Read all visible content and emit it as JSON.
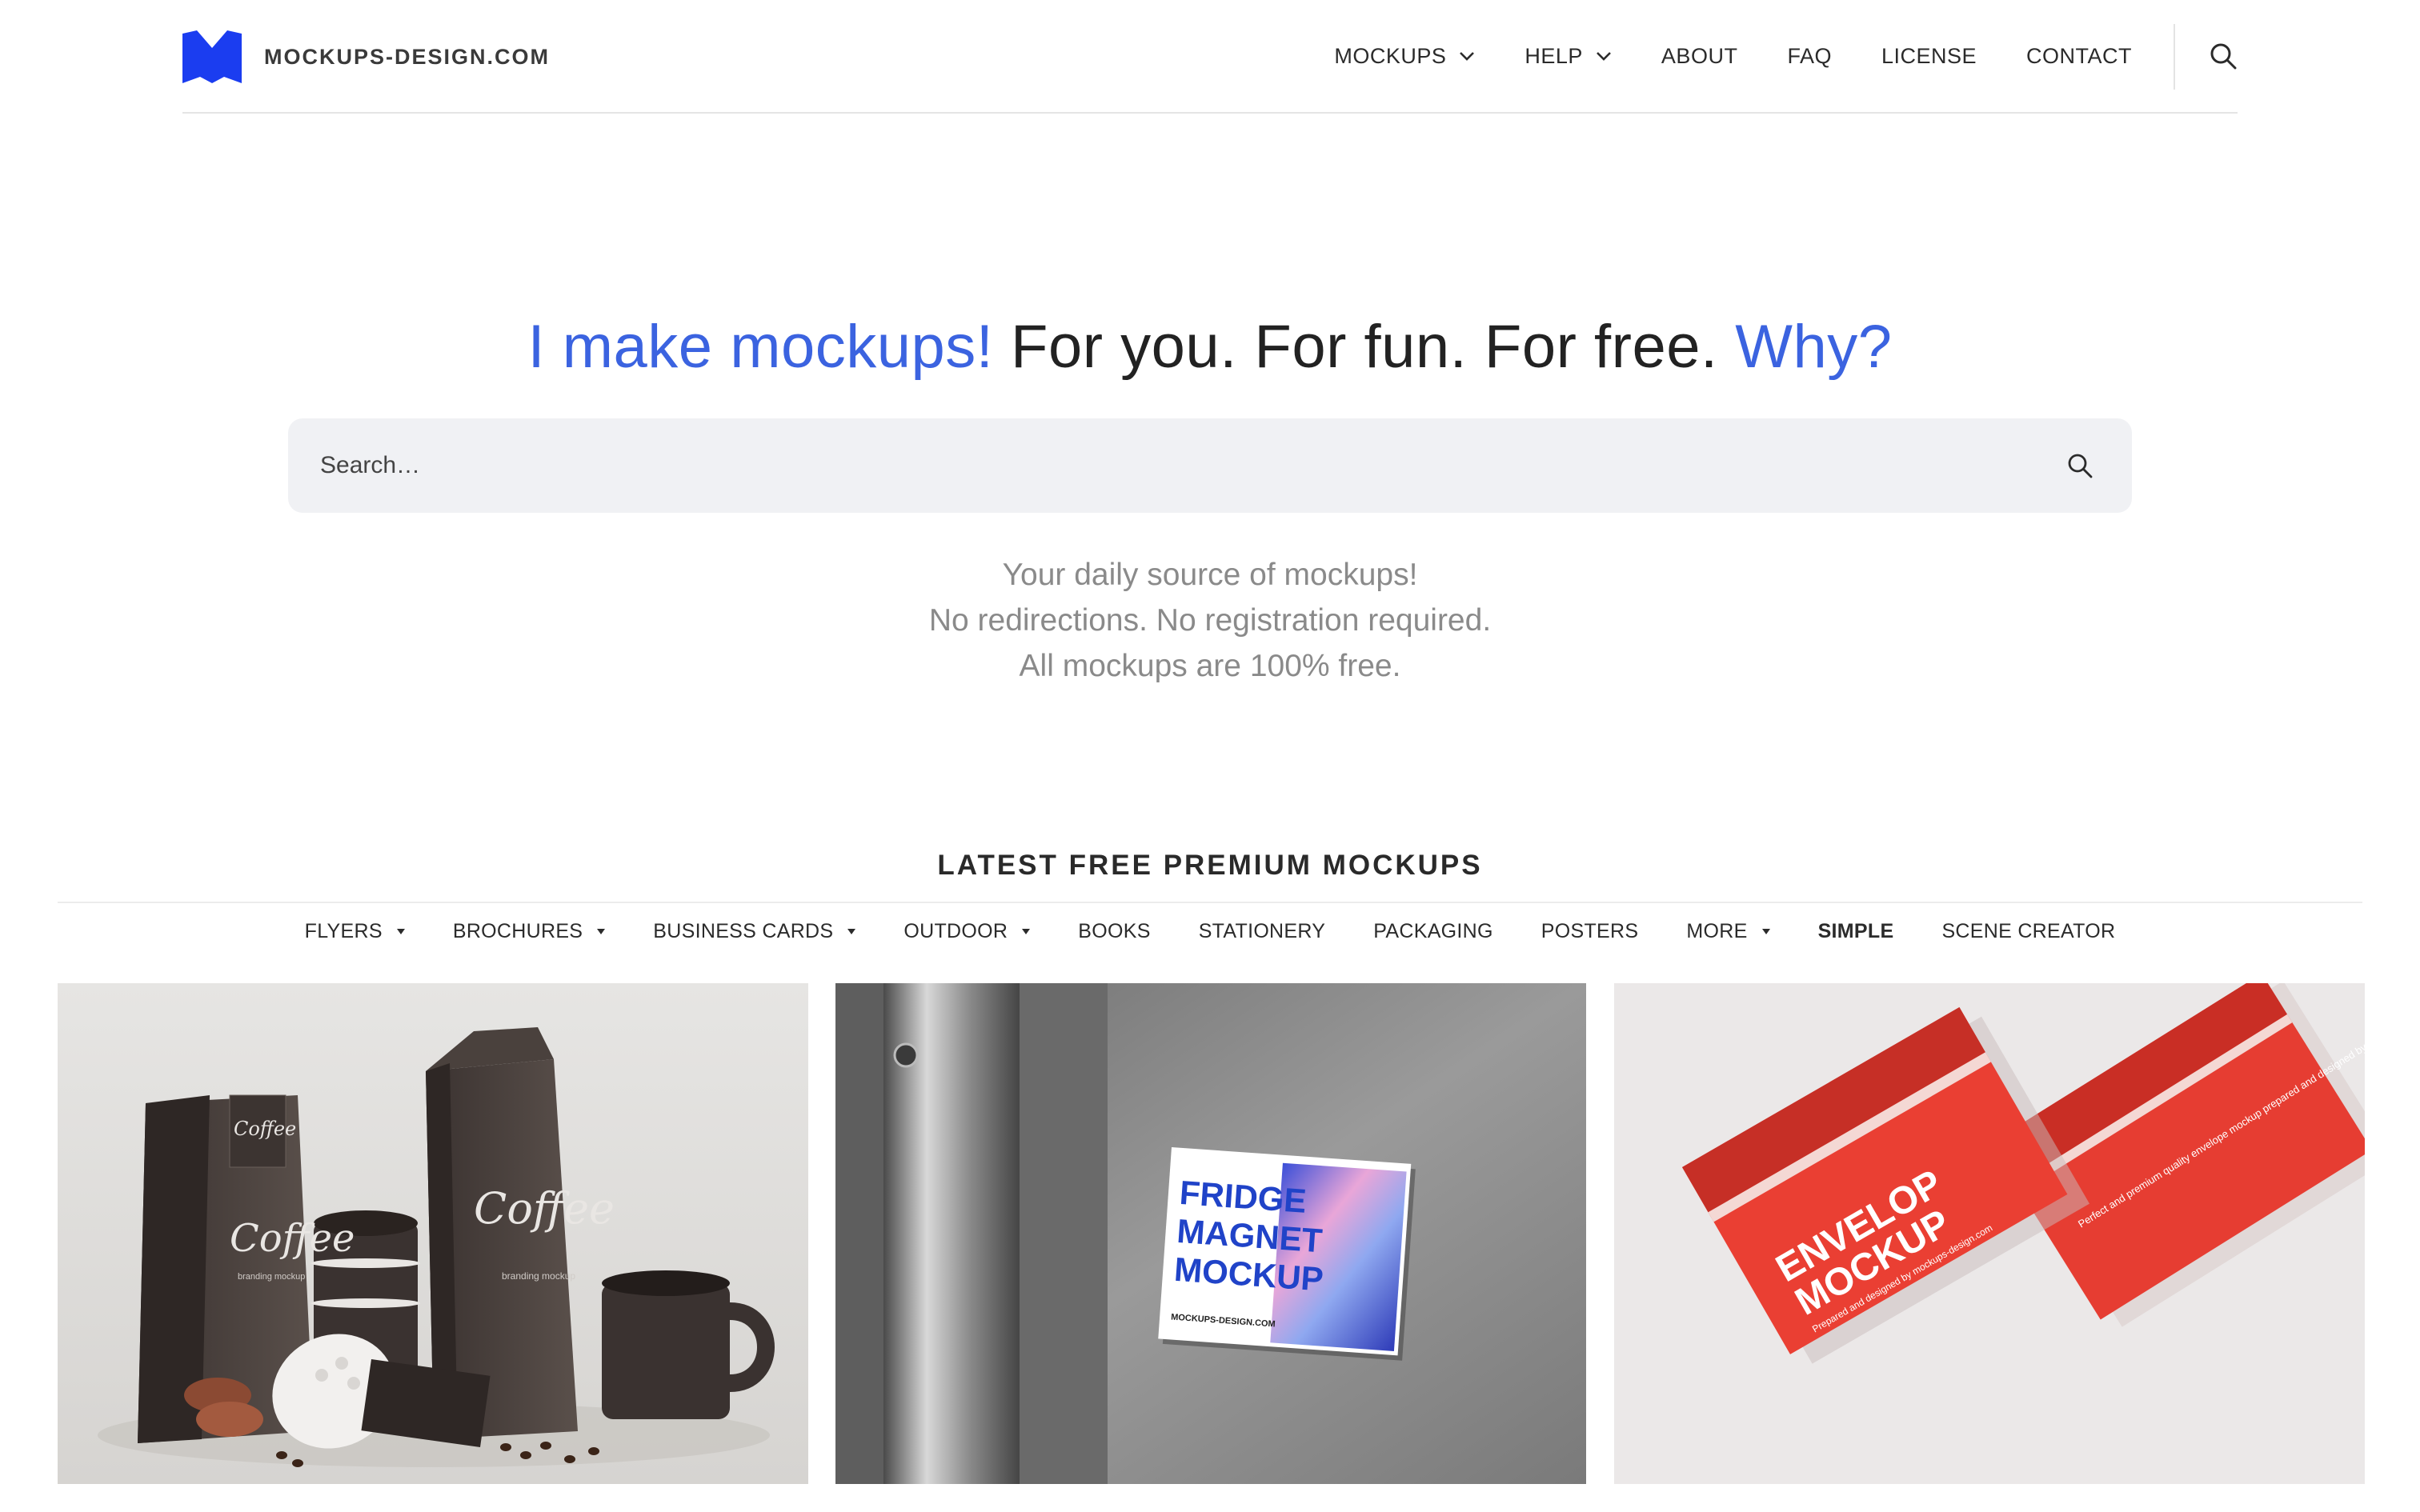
{
  "header": {
    "logo_text": "MOCKUPS-DESIGN.COM",
    "logo_color": "#1b3df0",
    "nav": [
      {
        "label": "MOCKUPS",
        "dropdown": true
      },
      {
        "label": "HELP",
        "dropdown": true
      },
      {
        "label": "ABOUT",
        "dropdown": false
      },
      {
        "label": "FAQ",
        "dropdown": false
      },
      {
        "label": "LICENSE",
        "dropdown": false
      },
      {
        "label": "CONTACT",
        "dropdown": false
      }
    ],
    "search_icon": "search-icon"
  },
  "hero": {
    "title_accent": "I make mockups!",
    "title_plain": " For you. For fun. For free. ",
    "title_link": "Why?",
    "accent_color": "#3b63e0",
    "search_placeholder": "Search…",
    "tagline": [
      "Your daily source of mockups!",
      "No redirections. No registration required.",
      "All mockups are 100% free."
    ]
  },
  "latest": {
    "title": "LATEST FREE PREMIUM MOCKUPS",
    "categories": [
      {
        "label": "FLYERS",
        "dropdown": true
      },
      {
        "label": "BROCHURES",
        "dropdown": true
      },
      {
        "label": "BUSINESS CARDS",
        "dropdown": true
      },
      {
        "label": "OUTDOOR",
        "dropdown": true
      },
      {
        "label": "BOOKS",
        "dropdown": false
      },
      {
        "label": "STATIONERY",
        "dropdown": false
      },
      {
        "label": "PACKAGING",
        "dropdown": false
      },
      {
        "label": "POSTERS",
        "dropdown": false
      },
      {
        "label": "MORE",
        "dropdown": true
      },
      {
        "label": "SIMPLE",
        "dropdown": false,
        "active": true
      },
      {
        "label": "SCENE CREATOR",
        "dropdown": false
      }
    ],
    "thumbnails": {
      "coffee": {
        "bag_text": "Coffee",
        "sub_text": "branding mockup"
      },
      "magnet": {
        "line1": "FRIDGE",
        "line2": "MAGNET",
        "line3": "MOCKUP",
        "site": "MOCKUPS-DESIGN.COM"
      },
      "envelope": {
        "line1": "ENVELOP",
        "line2": "MOCKUP",
        "caption": "Prepared and designed by mockups-design.com",
        "note": "Perfect and premium quality envelope mockup prepared and designed by mockups-design.com"
      }
    }
  }
}
